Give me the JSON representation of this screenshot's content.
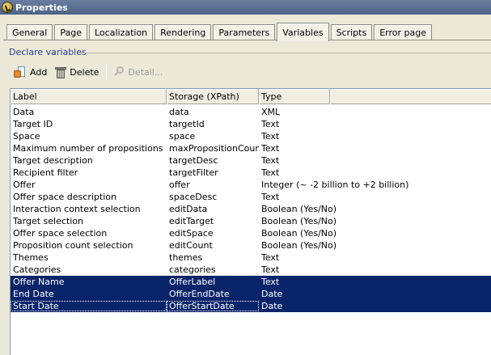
{
  "window": {
    "title": "Properties",
    "icon": "check-globe-icon"
  },
  "tabs": [
    {
      "label": "General",
      "active": false
    },
    {
      "label": "Page",
      "active": false
    },
    {
      "label": "Localization",
      "active": false
    },
    {
      "label": "Rendering",
      "active": false
    },
    {
      "label": "Parameters",
      "active": false
    },
    {
      "label": "Variables",
      "active": true
    },
    {
      "label": "Scripts",
      "active": false
    },
    {
      "label": "Error page",
      "active": false
    }
  ],
  "section": {
    "label": "Declare variables"
  },
  "toolbar": {
    "add_label": "Add",
    "delete_label": "Delete",
    "detail_label": "Detail...",
    "add_icon": "add-document-icon",
    "delete_icon": "trash-icon",
    "detail_icon": "magnifier-icon"
  },
  "table": {
    "columns": [
      "Label",
      "Storage (XPath)",
      "Type"
    ],
    "rows": [
      {
        "label": "Data",
        "storage": "data",
        "type": "XML",
        "selected": false
      },
      {
        "label": "Target ID",
        "storage": "targetId",
        "type": "Text",
        "selected": false
      },
      {
        "label": "Space",
        "storage": "space",
        "type": "Text",
        "selected": false
      },
      {
        "label": "Maximum number of propositions",
        "storage": "maxPropositionCount",
        "type": "Text",
        "selected": false
      },
      {
        "label": "Target description",
        "storage": "targetDesc",
        "type": "Text",
        "selected": false
      },
      {
        "label": "Recipient filter",
        "storage": "targetFilter",
        "type": "Text",
        "selected": false
      },
      {
        "label": "Offer",
        "storage": "offer",
        "type": "Integer (~ -2 billion to +2 billion)",
        "selected": false
      },
      {
        "label": "Offer space description",
        "storage": "spaceDesc",
        "type": "Text",
        "selected": false
      },
      {
        "label": "Interaction context selection",
        "storage": "editData",
        "type": "Boolean (Yes/No)",
        "selected": false
      },
      {
        "label": "Target selection",
        "storage": "editTarget",
        "type": "Boolean (Yes/No)",
        "selected": false
      },
      {
        "label": "Offer space selection",
        "storage": "editSpace",
        "type": "Boolean (Yes/No)",
        "selected": false
      },
      {
        "label": "Proposition count selection",
        "storage": "editCount",
        "type": "Boolean (Yes/No)",
        "selected": false
      },
      {
        "label": "Themes",
        "storage": "themes",
        "type": "Text",
        "selected": false
      },
      {
        "label": "Categories",
        "storage": "categories",
        "type": "Text",
        "selected": false
      },
      {
        "label": "Offer Name",
        "storage": "OfferLabel",
        "type": "Text",
        "selected": true
      },
      {
        "label": "End Date",
        "storage": "OfferEndDate",
        "type": "Date",
        "selected": true
      },
      {
        "label": "Start Date",
        "storage": "OfferStartDate",
        "type": "Date",
        "selected": true,
        "focused": true
      }
    ]
  },
  "colors": {
    "selection": "#0a246a",
    "section_label": "#1f3f8f",
    "titlebar": "#5a6f92"
  }
}
